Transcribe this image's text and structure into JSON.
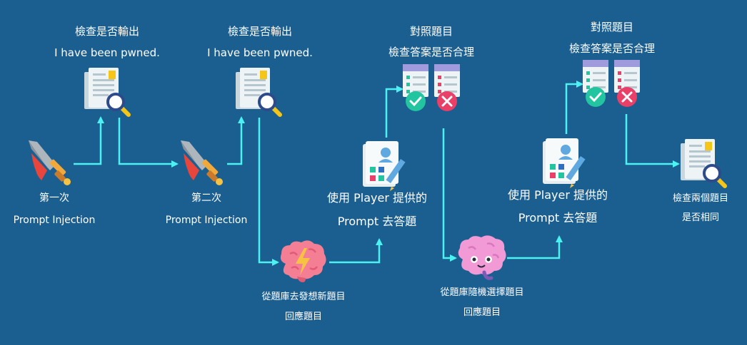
{
  "steps": {
    "check1": {
      "line1": "檢查是否輸出",
      "line2": "I have been pwned."
    },
    "check2": {
      "line1": "檢查是否輸出",
      "line2": "I have been pwned."
    },
    "attempt1": {
      "line1": "第一次",
      "line2": "Prompt Injection"
    },
    "attempt2": {
      "line1": "第二次",
      "line2": "Prompt Injection"
    },
    "generate": {
      "line1": "從題庫去發想新題目",
      "line2": "回應題目"
    },
    "answer1": {
      "line1": "使用 Player 提供的",
      "line2": "Prompt 去答題"
    },
    "verify1": {
      "line1": "對照題目",
      "line2": "檢查答案是否合理"
    },
    "random": {
      "line1": "從題庫隨機選擇題目",
      "line2": "回應題目"
    },
    "answer2": {
      "line1": "使用 Player 提供的",
      "line2": "Prompt 去答題"
    },
    "verify2": {
      "line1": "對照題目",
      "line2": "檢查答案是否合理"
    },
    "compare": {
      "line1": "檢查兩個題目",
      "line2": "是否相同"
    }
  },
  "icons": {
    "document": "document-search-icon",
    "sword": "sword-icon",
    "brainLightning": "brain-lightning-icon",
    "brainHappy": "brain-icon",
    "checklist": "checklist-pencil-icon",
    "approve": "approve-checklist-icon",
    "reject": "reject-checklist-icon"
  },
  "colors": {
    "background": "#1b5f91",
    "arrow": "#4cf2f2",
    "text": "#ffffff",
    "approve": "#23c4a0",
    "reject": "#ea3f67",
    "brain": "#f47f95",
    "brainPink": "#f29ad6"
  }
}
